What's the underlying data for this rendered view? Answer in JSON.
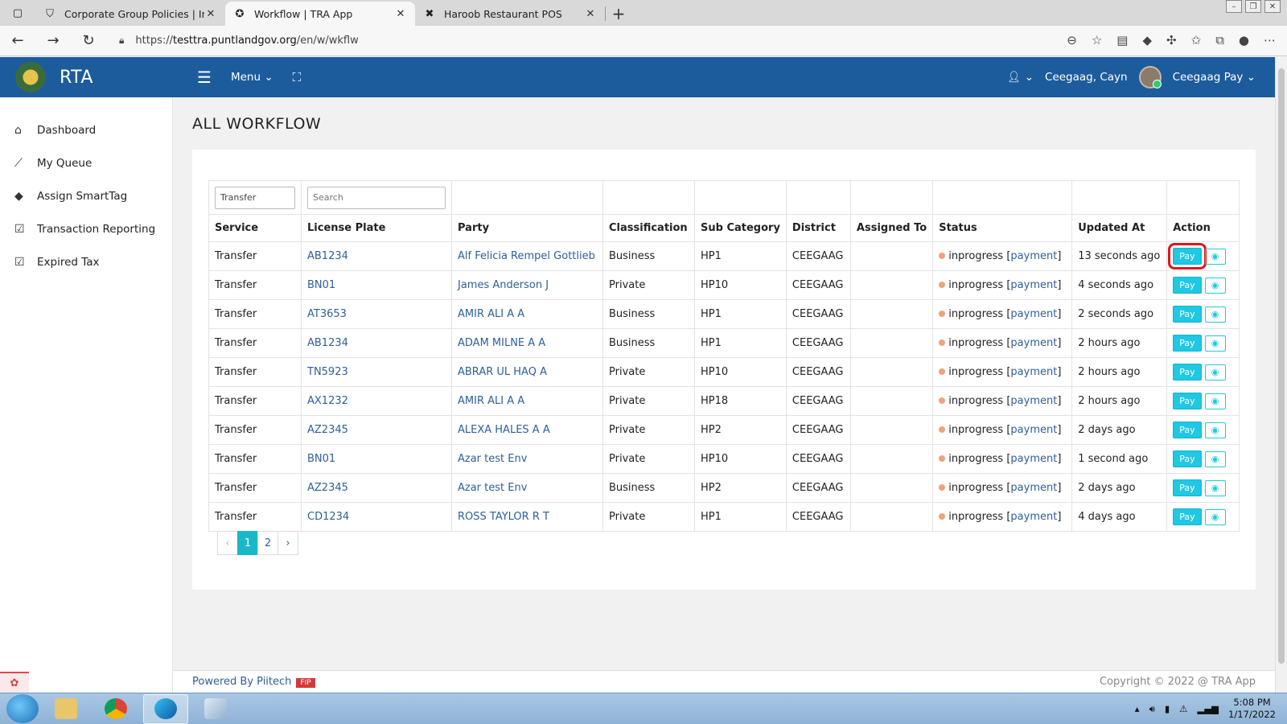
{
  "browser": {
    "tabs": [
      {
        "title": "Corporate Group Policies | Insura",
        "icon": "shield-icon",
        "active": false
      },
      {
        "title": "Workflow | TRA App",
        "icon": "rta-logo-icon",
        "active": true
      },
      {
        "title": "Haroob Restaurant POS",
        "icon": "cross-tools-icon",
        "active": false
      }
    ],
    "url_scheme": "https://",
    "url_host": "testtra.puntlandgov.org",
    "url_path": "/en/w/wkflw"
  },
  "header": {
    "brand": "RTA",
    "menu_label": "Menu",
    "user_office": "Ceegaag, Cayn",
    "user_name": "Ceegaag Pay"
  },
  "sidebar": {
    "items": [
      {
        "label": "Dashboard",
        "icon": "home-icon"
      },
      {
        "label": "My Queue",
        "icon": "trend-icon"
      },
      {
        "label": "Assign SmartTag",
        "icon": "tags-icon"
      },
      {
        "label": "Transaction Reporting",
        "icon": "checkbox-icon"
      },
      {
        "label": "Expired Tax",
        "icon": "checkbox-icon"
      }
    ]
  },
  "page": {
    "title": "ALL WORKFLOW"
  },
  "filters": {
    "service_value": "Transfer",
    "search_placeholder": "Search"
  },
  "table": {
    "columns": [
      "Service",
      "License Plate",
      "Party",
      "Classification",
      "Sub Category",
      "District",
      "Assigned To",
      "Status",
      "Updated At",
      "Action"
    ],
    "status_word": "inprogress",
    "status_link": "payment",
    "pay_label": "Pay",
    "rows": [
      {
        "service": "Transfer",
        "plate": "AB1234",
        "party": "Alf Felicia Rempel Gottlieb",
        "classification": "Business",
        "sub": "HP1",
        "district": "CEEGAAG",
        "assigned": "",
        "updated": "13 seconds ago"
      },
      {
        "service": "Transfer",
        "plate": "BN01",
        "party": "James Anderson J",
        "classification": "Private",
        "sub": "HP10",
        "district": "CEEGAAG",
        "assigned": "",
        "updated": "4 seconds ago"
      },
      {
        "service": "Transfer",
        "plate": "AT3653",
        "party": "AMIR ALI A A",
        "classification": "Business",
        "sub": "HP1",
        "district": "CEEGAAG",
        "assigned": "",
        "updated": "2 seconds ago"
      },
      {
        "service": "Transfer",
        "plate": "AB1234",
        "party": "ADAM MILNE A A",
        "classification": "Business",
        "sub": "HP1",
        "district": "CEEGAAG",
        "assigned": "",
        "updated": "2 hours ago"
      },
      {
        "service": "Transfer",
        "plate": "TN5923",
        "party": "ABRAR UL HAQ A",
        "classification": "Private",
        "sub": "HP10",
        "district": "CEEGAAG",
        "assigned": "",
        "updated": "2 hours ago"
      },
      {
        "service": "Transfer",
        "plate": "AX1232",
        "party": "AMIR ALI A A",
        "classification": "Private",
        "sub": "HP18",
        "district": "CEEGAAG",
        "assigned": "",
        "updated": "2 hours ago"
      },
      {
        "service": "Transfer",
        "plate": "AZ2345",
        "party": "ALEXA HALES A A",
        "classification": "Private",
        "sub": "HP2",
        "district": "CEEGAAG",
        "assigned": "",
        "updated": "2 days ago"
      },
      {
        "service": "Transfer",
        "plate": "BN01",
        "party": "Azar test Env",
        "classification": "Private",
        "sub": "HP10",
        "district": "CEEGAAG",
        "assigned": "",
        "updated": "1 second ago"
      },
      {
        "service": "Transfer",
        "plate": "AZ2345",
        "party": "Azar test Env",
        "classification": "Business",
        "sub": "HP2",
        "district": "CEEGAAG",
        "assigned": "",
        "updated": "2 days ago"
      },
      {
        "service": "Transfer",
        "plate": "CD1234",
        "party": "ROSS TAYLOR R T",
        "classification": "Private",
        "sub": "HP1",
        "district": "CEEGAAG",
        "assigned": "",
        "updated": "4 days ago"
      }
    ]
  },
  "pagination": {
    "prev": "‹",
    "pages": [
      "1",
      "2"
    ],
    "current": "1",
    "next": "›"
  },
  "footer": {
    "powered": "Powered By Piitech",
    "badge": "FIP",
    "copyright": "Copyright © 2022 @ TRA App"
  },
  "taskbar": {
    "time": "5:08 PM",
    "date": "1/17/2022"
  },
  "colors": {
    "header_blue": "#1c5c9d",
    "accent_cyan": "#1fc8e3",
    "status_dot": "#f0a27a",
    "highlight_red": "#e0151a"
  }
}
